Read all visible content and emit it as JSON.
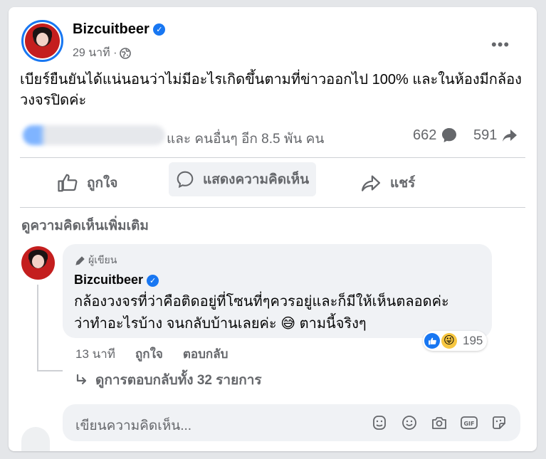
{
  "post": {
    "author": "Bizcuitbeer",
    "time": "29 นาที ·",
    "text": "เบียร์ยืนยันได้แน่นอนว่าไม่มีอะไรเกิดขึ้นตามที่ข่าวออกไป 100% และในห้องมีกล้องวงจรปิดค่ะ",
    "reactions_text": "และ คนอื่นๆ อีก 8.5 พัน คน",
    "comments_count": "662",
    "shares_count": "591"
  },
  "actions": {
    "like": "ถูกใจ",
    "comment": "แสดงความคิดเห็น",
    "share": "แชร์"
  },
  "more_comments": "ดูความคิดเห็นเพิ่มเติม",
  "comment": {
    "badge": "ผู้เขียน",
    "author": "Bizcuitbeer",
    "line1": "กล้องวงจรที่ว่าคือติดอยู่ที่โซนที่ๆควรอยู่และก็มีให้เห็นตลอดค่ะ",
    "line2": "ว่าทำอะไรบ้าง จนกลับบ้านเลยค่ะ 😅 ตามนี้จริงๆ",
    "reaction_count": "195",
    "time": "13 นาที",
    "like": "ถูกใจ",
    "reply": "ตอบกลับ",
    "view_replies": "ดูการตอบกลับทั้ง 32 รายการ"
  },
  "composer": {
    "placeholder": "เขียนความคิดเห็น..."
  },
  "colors": {
    "accent": "#1877f2",
    "text_secondary": "#65676b",
    "bubble": "#f0f2f5"
  }
}
